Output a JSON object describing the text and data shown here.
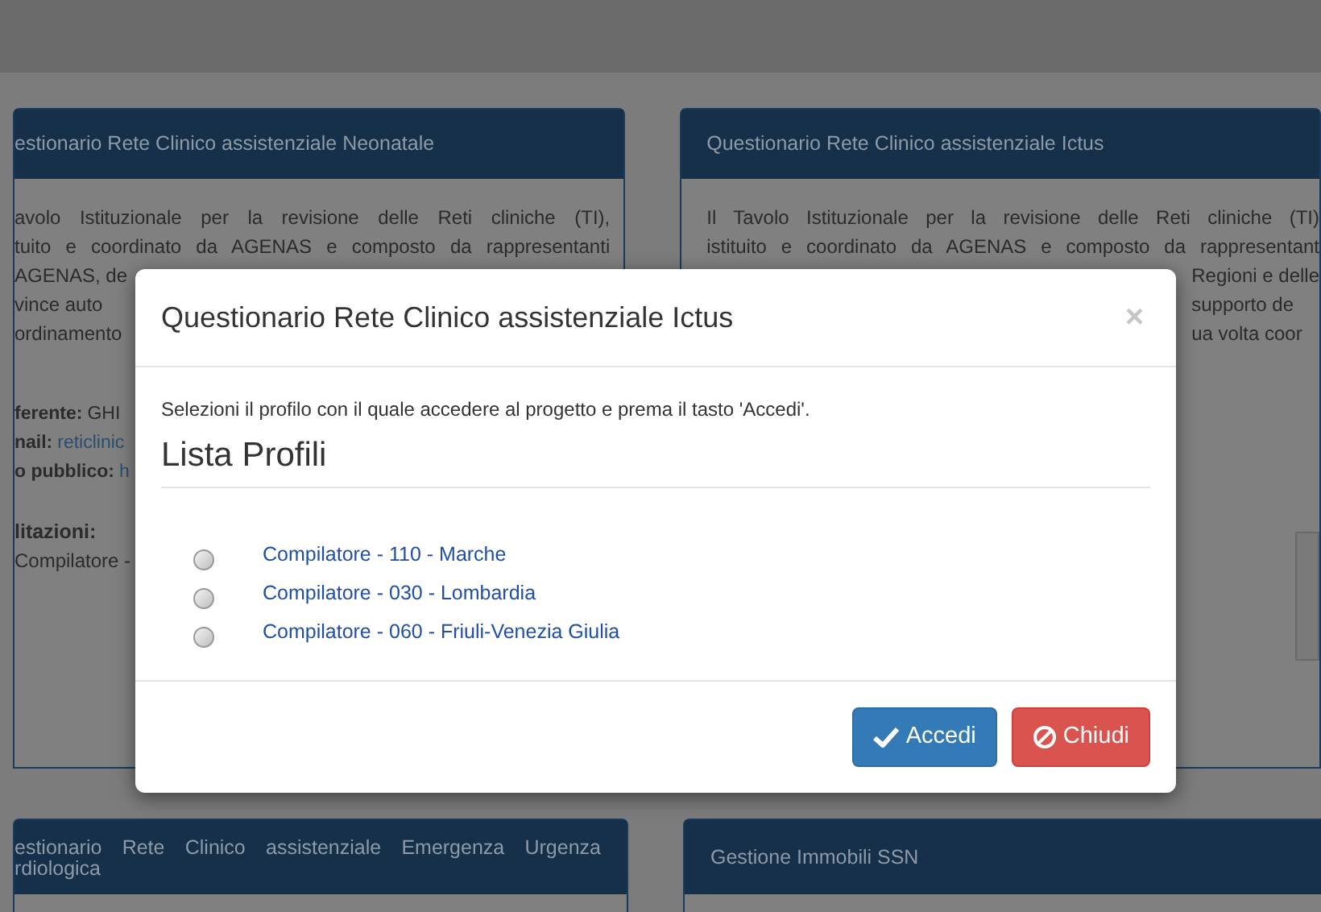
{
  "background_cards": [
    {
      "title": "estionario Rete Clinico assistenziale Neonatale",
      "paragraph": [
        "avolo Istituzionale per la revisione delle Reti cliniche (TI),",
        "tuito e coordinato da AGENAS e composto da rappresentanti",
        "AGENAS, de",
        "vince auto",
        "ordinamento"
      ],
      "fields": [
        {
          "label": "ferente:",
          "value": "GHI",
          "kind": "text"
        },
        {
          "label": "nail:",
          "value": "reticlinic",
          "kind": "link"
        },
        {
          "label": "o pubblico:",
          "value": "h",
          "kind": "link"
        }
      ],
      "section_label": "litazioni:",
      "section_items": [
        "Compilatore -"
      ]
    },
    {
      "title": "Questionario Rete Clinico assistenziale Ictus",
      "paragraph": [
        "Il Tavolo Istituzionale per la revisione delle Reti cliniche (TI)",
        "istituito e coordinato da AGENAS e composto da rappresentant",
        "Regioni e delle",
        "supporto de",
        "ua volta coor"
      ]
    }
  ],
  "bottom_cards": [
    {
      "title": "estionario Rete Clinico assistenziale Emergenza Urgenza",
      "title_line_2": "rdiologica"
    },
    {
      "title": "Gestione Immobili SSN"
    }
  ],
  "modal": {
    "title": "Questionario Rete Clinico assistenziale Ictus",
    "close": "×",
    "instructions": "Selezioni il profilo con il quale accedere al progetto e prema il tasto 'Accedi'.",
    "heading": "Lista Profili",
    "profiles": [
      {
        "label": "Compilatore - 110 - Marche",
        "selected": false
      },
      {
        "label": "Compilatore - 030 - Lombardia",
        "selected": false
      },
      {
        "label": "Compilatore - 060 - Friuli-Venezia Giulia",
        "selected": false
      }
    ],
    "buttons": [
      {
        "label": "Accedi",
        "kind": "primary"
      },
      {
        "label": "Chiudi",
        "kind": "danger"
      }
    ]
  }
}
